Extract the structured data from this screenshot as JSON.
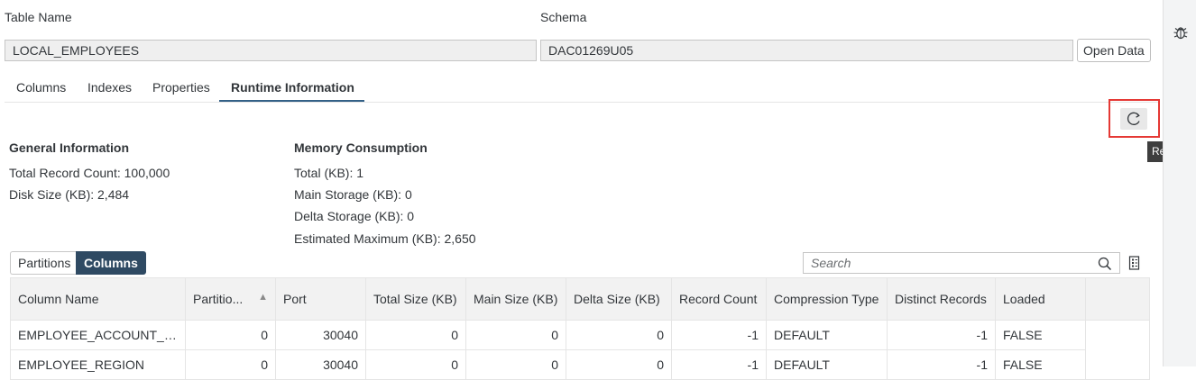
{
  "header": {
    "table_name_label": "Table Name",
    "schema_label": "Schema",
    "table_name_value": "LOCAL_EMPLOYEES",
    "schema_value": "DAC01269U05",
    "open_data_label": "Open Data"
  },
  "tabs": [
    {
      "label": "Columns",
      "active": false
    },
    {
      "label": "Indexes",
      "active": false
    },
    {
      "label": "Properties",
      "active": false
    },
    {
      "label": "Runtime Information",
      "active": true
    }
  ],
  "toolbar": {
    "refresh_tooltip": "Refresh",
    "refresh_icon": "refresh-icon"
  },
  "general_info": {
    "title": "General Information",
    "total_record_count": "Total Record Count: 100,000",
    "disk_size": "Disk Size (KB): 2,484"
  },
  "memory": {
    "title": "Memory Consumption",
    "total": "Total (KB): 1",
    "main_storage": "Main Storage (KB): 0",
    "delta_storage": "Delta Storage (KB): 0",
    "estimated_maximum": "Estimated Maximum (KB): 2,650"
  },
  "segmented": {
    "partitions_label": "Partitions",
    "columns_label": "Columns",
    "selected": "Columns"
  },
  "search": {
    "placeholder": "Search",
    "value": ""
  },
  "table": {
    "headers": [
      "Column Name",
      "Partitio...",
      "Port",
      "Total Size (KB)",
      "Main Size (KB)",
      "Delta Size (KB)",
      "Record Count",
      "Compression Type",
      "Distinct Records",
      "Loaded"
    ],
    "rows": [
      [
        "EMPLOYEE_ACCOUNT_NO",
        "0",
        "30040",
        "0",
        "0",
        "0",
        "-1",
        "DEFAULT",
        "-1",
        "FALSE"
      ],
      [
        "EMPLOYEE_REGION",
        "0",
        "30040",
        "0",
        "0",
        "0",
        "-1",
        "DEFAULT",
        "-1",
        "FALSE"
      ]
    ]
  },
  "colors": {
    "accent": "#346187",
    "selected_segment": "#2f4a63",
    "highlight_border": "#e53935",
    "tooltip_bg": "#3e3e3e"
  }
}
